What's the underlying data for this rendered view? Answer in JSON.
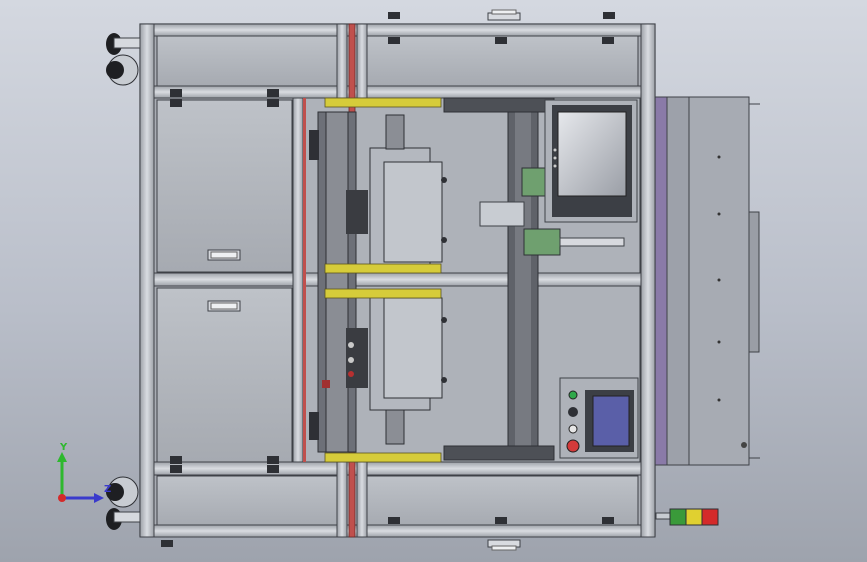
{
  "viewport": {
    "background_top": "#d4d8e0",
    "background_bottom": "#9ea3ad"
  },
  "machine": {
    "description_components": [
      "aluminum-profile-frame",
      "storage-drawer",
      "display-monitor",
      "control-panel",
      "signal-tower-light",
      "caster-wheel",
      "handle",
      "clamping-module",
      "linear-guide"
    ],
    "colors": {
      "frame_profile": "#c2c6cc",
      "frame_outline": "#3e4147",
      "panel_fill": "#b0b4bb",
      "rail_yellow": "#d6cc3a",
      "accent_red": "#c0504d",
      "side_purple": "#8a7aa8",
      "screen_frame": "#3c3f45",
      "hmi_screen": "#5a5fa8",
      "button_red": "#d43a3a",
      "button_green": "#2fa84a",
      "lamp_red": "#d42a2a",
      "lamp_yellow": "#e0d030",
      "lamp_green": "#3a9a3a"
    }
  },
  "triad": {
    "y_label": "Y",
    "z_label": "Z",
    "y_color": "#2eb82e",
    "x_color": "#d42a2a",
    "z_color": "#3a3acc"
  }
}
